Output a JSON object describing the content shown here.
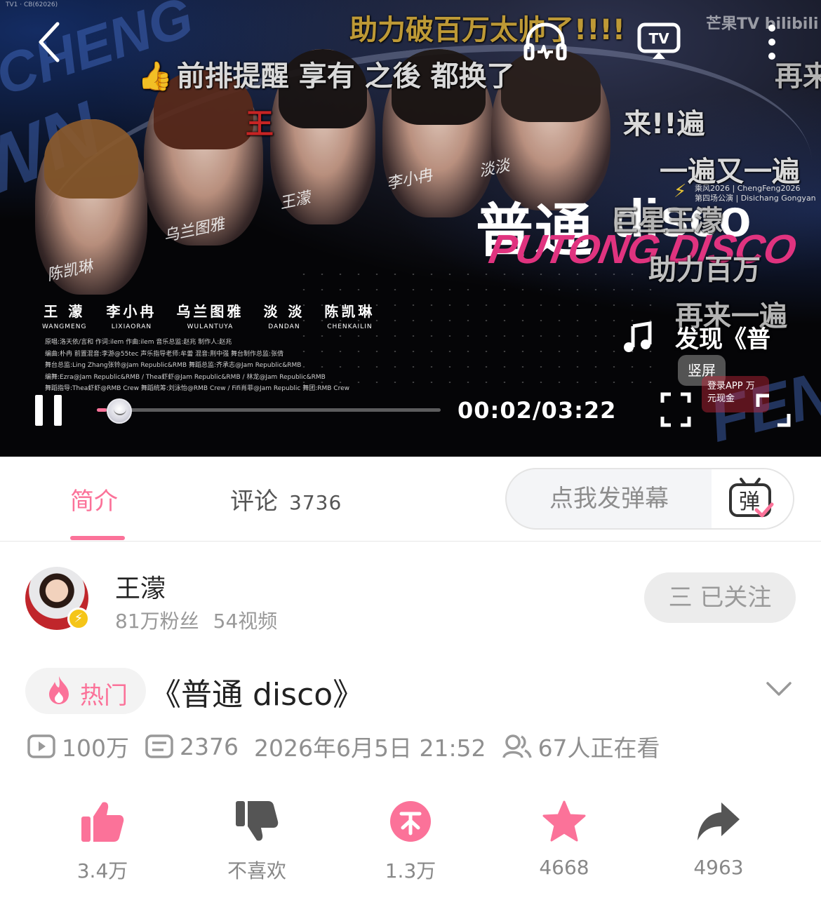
{
  "player": {
    "danmaku": [
      {
        "text": "助力破百万太帅了!!!!",
        "style": "gold"
      },
      {
        "text": "前排提醒   享有   之後   都换了",
        "style": "white",
        "thumb": true
      },
      {
        "text": "王",
        "style": "red"
      },
      {
        "text": "来!!遍",
        "style": "white"
      },
      {
        "text": "一遍又一遍",
        "style": "white"
      },
      {
        "text": "巨星王濛",
        "style": "white"
      },
      {
        "text": "助力百万",
        "style": "white"
      },
      {
        "text": "再来一遍",
        "style": "white"
      },
      {
        "text": "再来",
        "style": "white"
      }
    ],
    "watermark": "芒果TV bilibili",
    "top_left_tiny": "TV1 · CB(62026)",
    "show_logo_cn": "普通",
    "show_logo_disco": "disco",
    "show_logo_en": "PUTONG DISCO",
    "event_info": [
      "乘风2026 | ChengFeng2026",
      "第四场公演 | Disichang Gongyan"
    ],
    "signatures": [
      "陈凯琳",
      "乌兰图雅",
      "王濛",
      "李小冉",
      "淡淡"
    ],
    "performers": [
      {
        "cn": "王 濛",
        "en": "WANGMENG"
      },
      {
        "cn": "李小冉",
        "en": "LIXIAORAN"
      },
      {
        "cn": "乌兰图雅",
        "en": "WULANTUYA"
      },
      {
        "cn": "淡 淡",
        "en": "DANDAN"
      },
      {
        "cn": "陈凯琳",
        "en": "CHENKAILIN"
      }
    ],
    "credits": [
      "原唱:洛天依/言和   作词:ilem   作曲:ilem   音乐总监:赵兆   制作人:赵兆",
      "编曲:朴冉   前置混音:李游@55tec   声乐指导老师:牟蕾   混音:荆中强   舞台制作总监:张倩",
      "舞台总监:Ling Zhang张铃@Jam Republic&RMB   舞蹈总监:齐承志@Jam Republic&RMB",
      "编舞:Ezra@Jam Republic&RMB / Thea虾虾@Jam Republic&RMB / 林龙@Jam Republic&RMB",
      "舞蹈指导:Thea虾虾@RMB Crew   舞蹈统筹:刘泳怡@RMB Crew / Fifi肖菲@Jam Republic   舞团:RMB Crew"
    ],
    "music_text": "发现《普",
    "vertical_label": "竖屏",
    "promo_text": "登录APP  万元现金",
    "time_display": "00:02/03:22",
    "progress": 0.01,
    "icons": [
      "back-icon",
      "headphone-icon",
      "tv-cast-icon",
      "more-icon",
      "music-note-icon",
      "pause-icon",
      "fullscreen-icon",
      "expand-icon"
    ]
  },
  "tabs": {
    "intro": "简介",
    "comments": "评论",
    "comments_count": "3736",
    "danmaku_placeholder": "点我发弹幕",
    "danmaku_send_glyph": "弹"
  },
  "uploader": {
    "name": "王濛",
    "fans": "81万粉丝",
    "videos": "54视频",
    "follow_label": "三 已关注"
  },
  "video": {
    "hot_label": "热门",
    "title": "《普通 disco》",
    "views": "100万",
    "danmaku_count": "2376",
    "publish_time": "2026年6月5日 21:52",
    "watching": "67人正在看"
  },
  "actions": {
    "like": "3.4万",
    "dislike": "不喜欢",
    "coin": "1.3万",
    "favorite": "4668",
    "share": "4963"
  },
  "colors": {
    "accent": "#fb7299",
    "muted_text": "#8f8f8f",
    "action_gray": "#555555"
  }
}
